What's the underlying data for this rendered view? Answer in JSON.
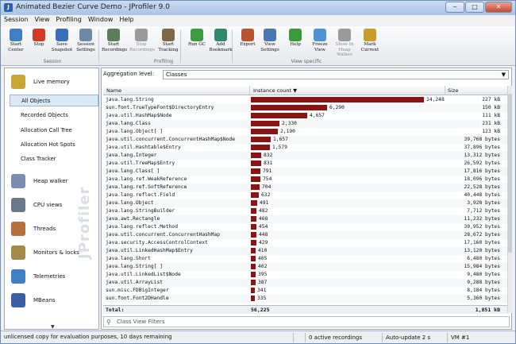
{
  "window": {
    "title": "Animated Bezier Curve Demo - JProfiler 9.0",
    "controls": [
      "‒",
      "□",
      "✕"
    ]
  },
  "menu": [
    "Session",
    "View",
    "Profiling",
    "Window",
    "Help"
  ],
  "toolbar": {
    "buttons": [
      {
        "label": "Start\nCenter",
        "icon": "start-center-icon",
        "color": "#3f7fc4"
      },
      {
        "label": "Stop",
        "icon": "stop-icon",
        "color": "#d13a25"
      },
      {
        "label": "Save\nSnapshot",
        "icon": "save-icon",
        "color": "#3a6fb5"
      },
      {
        "label": "Session\nSettings",
        "icon": "session-settings-icon",
        "color": "#6b8aa8"
      },
      {
        "label": "Start\nRecordings",
        "icon": "start-recordings-icon",
        "color": "#5b7f5b"
      },
      {
        "label": "Stop\nRecordings",
        "icon": "stop-recordings-icon",
        "color": "#9a9a9a"
      },
      {
        "label": "Start\nTracking",
        "icon": "start-tracking-icon",
        "color": "#7a6a4a"
      },
      {
        "label": "Run GC",
        "icon": "run-gc-icon",
        "color": "#3e9a3e"
      },
      {
        "label": "Add\nBookmark",
        "icon": "add-bookmark-icon",
        "color": "#2f8a6a"
      },
      {
        "label": "Export",
        "icon": "export-icon",
        "color": "#b8552d"
      },
      {
        "label": "View\nSettings",
        "icon": "view-settings-icon",
        "color": "#4a78b0"
      },
      {
        "label": "Help",
        "icon": "help-icon",
        "color": "#3a9a3a"
      },
      {
        "label": "Freeze\nView",
        "icon": "freeze-view-icon",
        "color": "#4e94d4"
      },
      {
        "label": "Show In\nHeap Walker",
        "icon": "show-heap-walker-icon",
        "color": "#9a9a9a"
      },
      {
        "label": "Mark\nCurrent",
        "icon": "mark-current-icon",
        "color": "#c89b2a"
      }
    ],
    "groups": [
      "Session",
      "Profiling",
      "View specific"
    ]
  },
  "sidebar": {
    "sections": [
      {
        "label": "Live memory",
        "icon": "live-memory-icon",
        "color": "#c8a536"
      },
      {
        "label": "Heap walker",
        "icon": "heap-walker-icon",
        "color": "#7a8fb0"
      },
      {
        "label": "CPU views",
        "icon": "cpu-views-icon",
        "color": "#6a7a8a"
      },
      {
        "label": "Threads",
        "icon": "threads-icon",
        "color": "#b56f3a"
      },
      {
        "label": "Monitors & locks",
        "icon": "monitors-locks-icon",
        "color": "#a58a4a"
      },
      {
        "label": "Telemetries",
        "icon": "telemetries-icon",
        "color": "#3f7fc4"
      },
      {
        "label": "MBeans",
        "icon": "mbeans-icon",
        "color": "#3a5fa8"
      }
    ],
    "live_memory_items": [
      "All Objects",
      "Recorded Objects",
      "Allocation Call Tree",
      "Allocation Hot Spots",
      "Class Tracker"
    ],
    "watermark": "JProfiler"
  },
  "main": {
    "aggregation_label": "Aggregation level:",
    "aggregation_value": "Classes",
    "columns": [
      "Name",
      "Instance count ▼",
      "Size"
    ],
    "rows": [
      {
        "name": "java.lang.String",
        "count": "14,248",
        "n": 14248,
        "size": "227 kB"
      },
      {
        "name": "sun.font.TrueTypeFont$DirectoryEntry",
        "count": "6,290",
        "n": 6290,
        "size": "150 kB"
      },
      {
        "name": "java.util.HashMap$Node",
        "count": "4,657",
        "n": 4657,
        "size": "111 kB"
      },
      {
        "name": "java.lang.Class",
        "count": "2,330",
        "n": 2330,
        "size": "231 kB"
      },
      {
        "name": "java.lang.Object[ ]",
        "count": "2,190",
        "n": 2190,
        "size": "123 kB"
      },
      {
        "name": "java.util.concurrent.ConcurrentHashMap$Node",
        "count": "1,657",
        "n": 1657,
        "size": "39,768 bytes"
      },
      {
        "name": "java.util.Hashtable$Entry",
        "count": "1,579",
        "n": 1579,
        "size": "37,896 bytes"
      },
      {
        "name": "java.lang.Integer",
        "count": "832",
        "n": 832,
        "size": "13,312 bytes"
      },
      {
        "name": "java.util.TreeMap$Entry",
        "count": "831",
        "n": 831,
        "size": "26,592 bytes"
      },
      {
        "name": "java.lang.Class[ ]",
        "count": "791",
        "n": 791,
        "size": "17,816 bytes"
      },
      {
        "name": "java.lang.ref.WeakReference",
        "count": "754",
        "n": 754,
        "size": "18,096 bytes"
      },
      {
        "name": "java.lang.ref.SoftReference",
        "count": "704",
        "n": 704,
        "size": "22,528 bytes"
      },
      {
        "name": "java.lang.reflect.Field",
        "count": "632",
        "n": 632,
        "size": "40,448 bytes"
      },
      {
        "name": "java.lang.Object",
        "count": "491",
        "n": 491,
        "size": "3,928 bytes"
      },
      {
        "name": "java.lang.StringBuilder",
        "count": "482",
        "n": 482,
        "size": "7,712 bytes"
      },
      {
        "name": "java.awt.Rectangle",
        "count": "468",
        "n": 468,
        "size": "11,232 bytes"
      },
      {
        "name": "java.lang.reflect.Method",
        "count": "454",
        "n": 454,
        "size": "39,952 bytes"
      },
      {
        "name": "java.util.concurrent.ConcurrentHashMap",
        "count": "448",
        "n": 448,
        "size": "28,672 bytes"
      },
      {
        "name": "java.security.AccessControlContext",
        "count": "429",
        "n": 429,
        "size": "17,160 bytes"
      },
      {
        "name": "java.util.LinkedHashMap$Entry",
        "count": "410",
        "n": 410,
        "size": "13,120 bytes"
      },
      {
        "name": "java.lang.Short",
        "count": "405",
        "n": 405,
        "size": "6,480 bytes"
      },
      {
        "name": "java.lang.String[ ]",
        "count": "402",
        "n": 402,
        "size": "15,984 bytes"
      },
      {
        "name": "java.util.LinkedList$Node",
        "count": "395",
        "n": 395,
        "size": "9,480 bytes"
      },
      {
        "name": "java.util.ArrayList",
        "count": "387",
        "n": 387,
        "size": "9,288 bytes"
      },
      {
        "name": "sun.misc.FDBigInteger",
        "count": "341",
        "n": 341,
        "size": "8,184 bytes"
      },
      {
        "name": "sun.font.Font2DHandle",
        "count": "335",
        "n": 335,
        "size": "5,360 bytes"
      }
    ],
    "total_label": "Total:",
    "total_count": "56,225",
    "total_size": "1,851 kB",
    "filter_placeholder": "Class View Filters"
  },
  "status": {
    "message": "unlicensed copy for evaluation purposes, 10 days remaining",
    "recordings": "0 active recordings",
    "update": "Auto-update 2 s",
    "vm": "VM #1"
  },
  "bar_color": "#8a1414"
}
